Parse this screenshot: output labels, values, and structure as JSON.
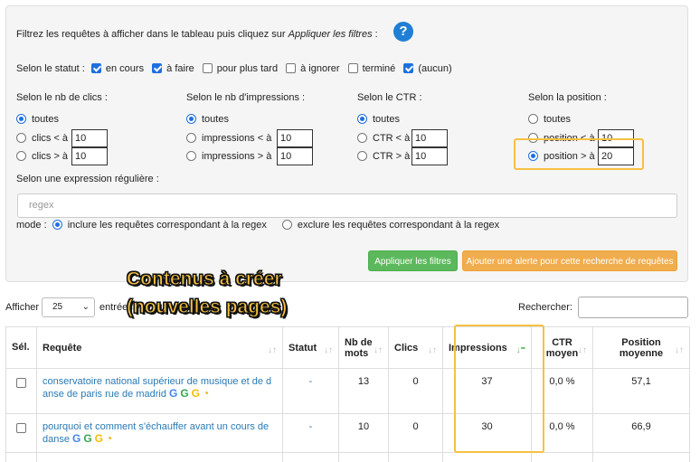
{
  "filters": {
    "intro_text": "Filtrez les requêtes à afficher dans le tableau puis cliquez sur ",
    "intro_emph": "Appliquer les filtres",
    "intro_tail": " :",
    "help_glyph": "?",
    "status": {
      "label": "Selon le statut :",
      "options": [
        {
          "label": "en cours",
          "checked": true
        },
        {
          "label": "à faire",
          "checked": true
        },
        {
          "label": "pour plus tard",
          "checked": false
        },
        {
          "label": "à ignorer",
          "checked": false
        },
        {
          "label": "terminé",
          "checked": false
        },
        {
          "label": "(aucun)",
          "checked": true
        }
      ]
    },
    "clicks": {
      "label": "Selon le nb de clics :",
      "all": "toutes",
      "lt": "clics < à",
      "gt": "clics > à",
      "lt_value": "10",
      "gt_value": "10"
    },
    "impressions": {
      "label": "Selon le nb d'impressions :",
      "all": "toutes",
      "lt": "impressions < à",
      "gt": "impressions > à",
      "lt_value": "10",
      "gt_value": "10"
    },
    "ctr": {
      "label": "Selon le CTR :",
      "all": "toutes",
      "lt": "CTR < à",
      "gt": "CTR > à",
      "lt_value": "10",
      "gt_value": "10"
    },
    "position": {
      "label": "Selon la position :",
      "all": "toutes",
      "lt": "position < à",
      "gt": "position > à",
      "lt_value": "10",
      "gt_value": "20"
    },
    "regex": {
      "label": "Selon une expression régulière :",
      "placeholder": "regex",
      "mode_label": "mode :",
      "include": "inclure les requêtes correspondant à la regex",
      "exclude": "exclure les requêtes correspondant à la regex"
    },
    "apply_button": "Appliquer les filtres",
    "alert_button": "Ajouter une alerte pour cette recherche de requêtes"
  },
  "table_controls": {
    "show_label": "Afficher",
    "page_size": "25",
    "entries_label": "entrées",
    "search_label": "Rechercher:"
  },
  "overlay": {
    "line1": "Contenus à créer",
    "line2": "(nouvelles pages)"
  },
  "table": {
    "headers": {
      "sel": "Sél.",
      "query": "Requête",
      "status": "Statut",
      "words_l1": "Nb de",
      "words_l2": "mots",
      "clicks": "Clics",
      "impressions": "Impressions",
      "ctr_l1": "CTR",
      "ctr_l2": "moyen",
      "pos_l1": "Position",
      "pos_l2": "moyenne"
    },
    "rows": [
      {
        "query_l1": "conservatoire national supérieur de musique et de d",
        "query_l2": "anse de paris rue de madrid",
        "status": "-",
        "words": "13",
        "clicks": "0",
        "impressions": "37",
        "ctr": "0,0 %",
        "position": "57,1"
      },
      {
        "query_l1": "pourquoi et comment s'échauffer avant un cours de",
        "query_l2": "danse",
        "status": "-",
        "words": "10",
        "clicks": "0",
        "impressions": "30",
        "ctr": "0,0 %",
        "position": "66,9"
      }
    ]
  },
  "colors": {
    "accent_blue": "#1f6fe0",
    "highlight_yellow": "#f6c141",
    "green_button": "#5cb85c",
    "orange_button": "#f0ad4e",
    "link": "#2a7ab5"
  }
}
